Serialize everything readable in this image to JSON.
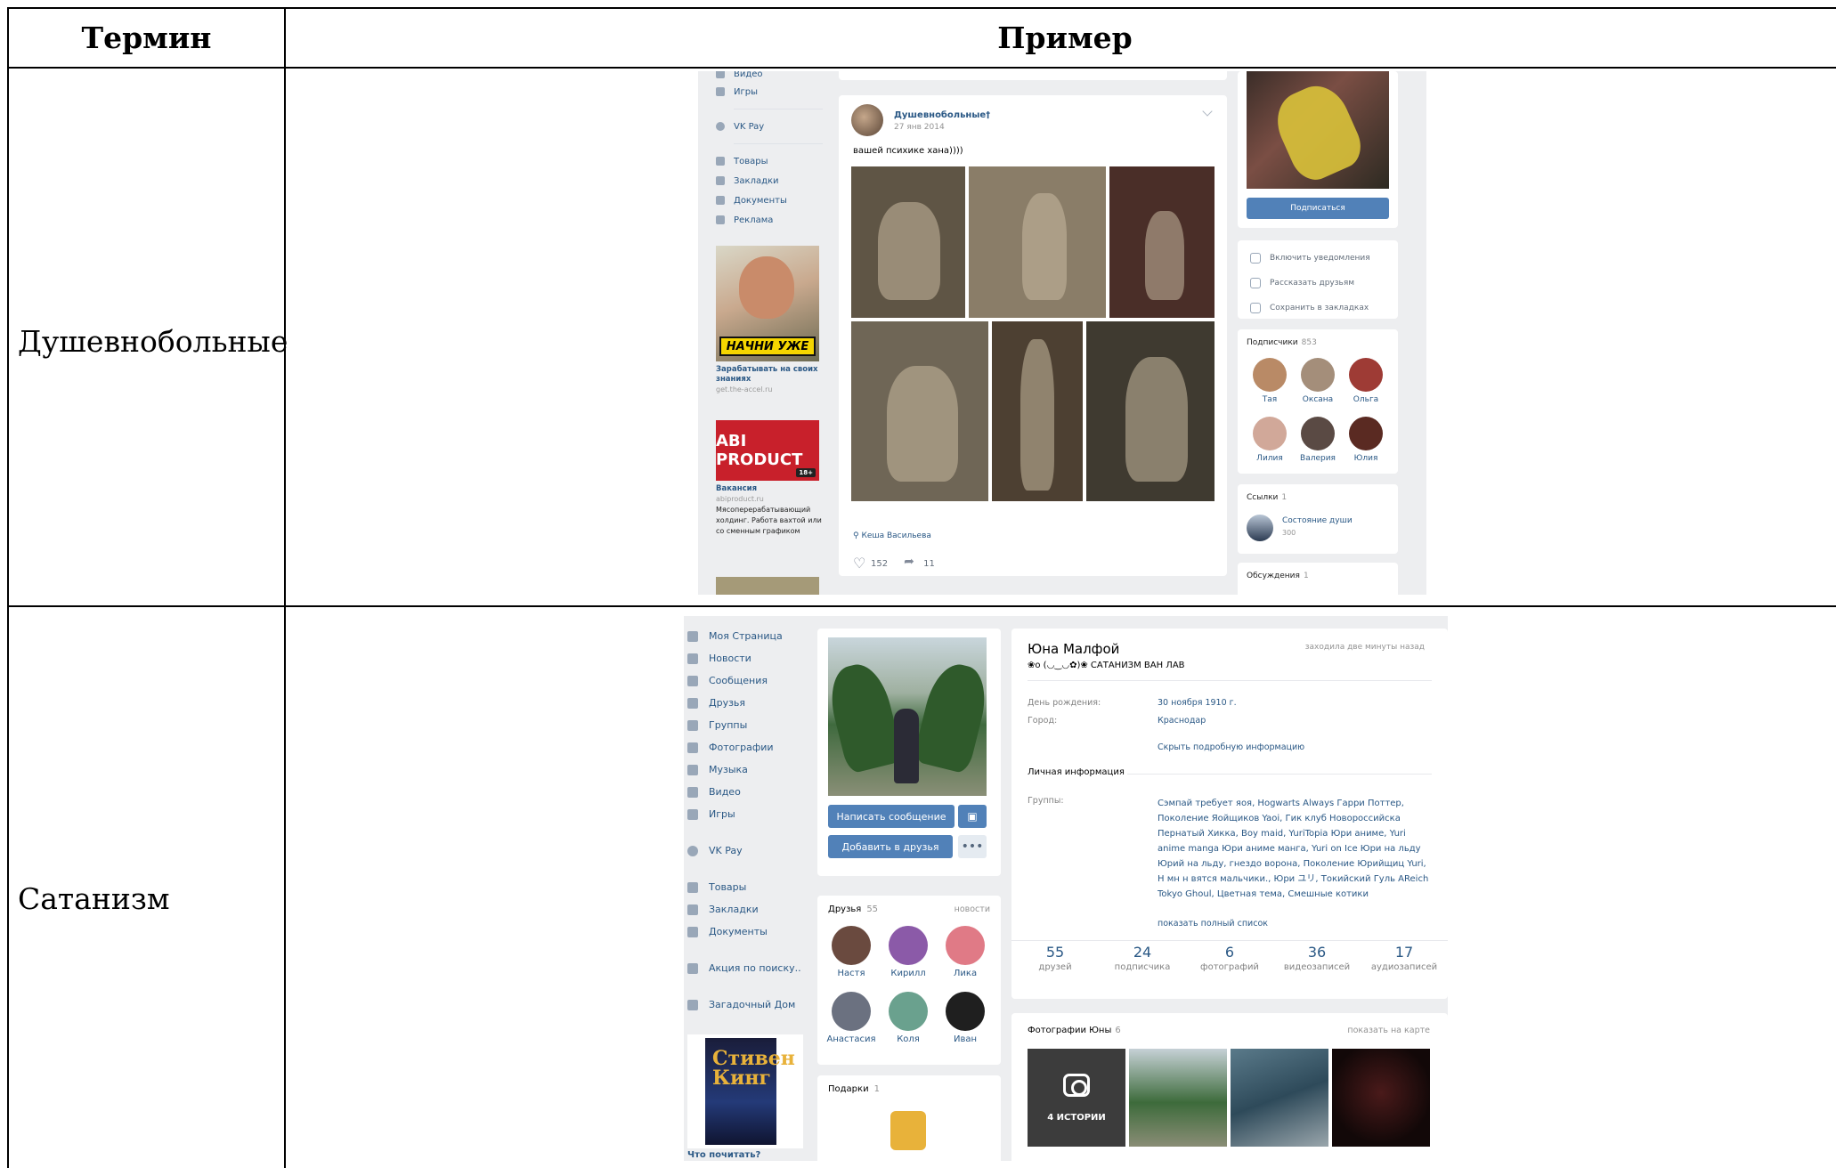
{
  "table": {
    "header_term": "Термин",
    "header_example": "Пример",
    "rows": [
      {
        "term": "Душевнобольные"
      },
      {
        "term": "Сатанизм"
      }
    ]
  },
  "shot1": {
    "nav": [
      {
        "label": "Видео",
        "icon": "video-icon"
      },
      {
        "label": "Игры",
        "icon": "games-icon"
      },
      {
        "label": "VK Pay",
        "icon": "vkpay-icon"
      },
      {
        "label": "Товары",
        "icon": "goods-icon"
      },
      {
        "label": "Закладки",
        "icon": "star-icon"
      },
      {
        "label": "Документы",
        "icon": "document-icon"
      },
      {
        "label": "Реклама",
        "icon": "megaphone-icon"
      }
    ],
    "ad1": {
      "banner": "НАЧНИ УЖЕ",
      "title": "Зарабатывать на своих знаниях",
      "url": "get.the-accel.ru"
    },
    "ad2": {
      "brand": "ABI PRODUCT",
      "age": "18+",
      "title": "Вакансия",
      "url": "abiproduct.ru",
      "desc": "Мясоперерабатывающий холдинг. Работа вахтой или со сменным графиком"
    },
    "post": {
      "author": "Душевнобольные†",
      "date": "27 янв 2014",
      "text": "вашей психике хана))))",
      "signed": "Кеша Васильева",
      "likes": "152",
      "shares": "11"
    },
    "right": {
      "subscribe": "Подписаться",
      "actions": [
        "Включить уведомления",
        "Рассказать друзьям",
        "Сохранить в закладках"
      ],
      "members_title": "Подписчики",
      "members_count": "853",
      "members": [
        "Тая",
        "Оксана",
        "Ольга",
        "Лилия",
        "Валерия",
        "Юлия"
      ],
      "links_title": "Ссылки",
      "links_count": "1",
      "link_name": "Состояние души",
      "link_sub": "300",
      "discussions_title": "Обсуждения",
      "discussions_count": "1"
    }
  },
  "shot2": {
    "nav": [
      {
        "label": "Моя Страница",
        "icon": "home-icon"
      },
      {
        "label": "Новости",
        "icon": "news-icon"
      },
      {
        "label": "Сообщения",
        "icon": "messages-icon"
      },
      {
        "label": "Друзья",
        "icon": "friend-icon"
      },
      {
        "label": "Группы",
        "icon": "groups-icon"
      },
      {
        "label": "Фотографии",
        "icon": "camera-icon"
      },
      {
        "label": "Музыка",
        "icon": "music-icon"
      },
      {
        "label": "Видео",
        "icon": "video-icon"
      },
      {
        "label": "Игры",
        "icon": "games-icon"
      },
      {
        "label": "VK Pay",
        "icon": "vkpay-icon"
      },
      {
        "label": "Товары",
        "icon": "goods-icon"
      },
      {
        "label": "Закладки",
        "icon": "star-icon"
      },
      {
        "label": "Документы",
        "icon": "document-icon"
      },
      {
        "label": "Акция по поиску..",
        "icon": "people-icon"
      },
      {
        "label": "Загадочный Дом",
        "icon": "rocket-icon"
      }
    ],
    "book_title": "Стивен Кинг",
    "book_caption": "Что почитать?",
    "buttons": {
      "message": "Написать сообщение",
      "add_friend": "Добавить в друзья",
      "more": "•••"
    },
    "friends_title": "Друзья",
    "friends_count": "55",
    "friends_news": "новости",
    "friends": [
      "Настя",
      "Кирилл",
      "Лика",
      "Анастасия",
      "Коля",
      "Иван"
    ],
    "gifts_title": "Подарки",
    "gifts_count": "1",
    "profile": {
      "name": "Юна Малфой",
      "status": "❀o (◡‿◡✿)❀ САТАНИЗМ ВАН ЛАВ",
      "online": "заходила две минуты назад",
      "birthday_label": "День рождения:",
      "birthday": "30 ноября 1910 г.",
      "city_label": "Город:",
      "city": "Краснодар",
      "hide_info": "Скрыть подробную информацию",
      "personal_label": "Личная информация",
      "groups_label": "Группы:",
      "groups": "Сэмпай требует яоя, Hogwarts Always Гарри Поттер, Поколение Яойщиков Yaoi, Гик клуб Новороссийска Пернатый Хикка, Boy maid, YuriTopia Юри аниме, Yuri anime manga Юри аниме манга, Yuri on Ice Юри на льду Юрий на льду, гнездо ворона, Поколение Юрийщиц Yuri, Н мн н вятся мальчики., Юри ユリ, Токийский Гуль AReich Tokyo Ghoul, Цветная тема, Смешные котики",
      "show_all": "показать полный список",
      "counters": [
        {
          "n": "55",
          "l": "друзей"
        },
        {
          "n": "24",
          "l": "подписчика"
        },
        {
          "n": "6",
          "l": "фотографий"
        },
        {
          "n": "36",
          "l": "видеозаписей"
        },
        {
          "n": "17",
          "l": "аудиозаписей"
        }
      ]
    },
    "photos_title": "Фотографии Юны",
    "photos_count": "6",
    "photos_map": "показать на карте",
    "stories_label": "4 ИСТОРИИ"
  }
}
